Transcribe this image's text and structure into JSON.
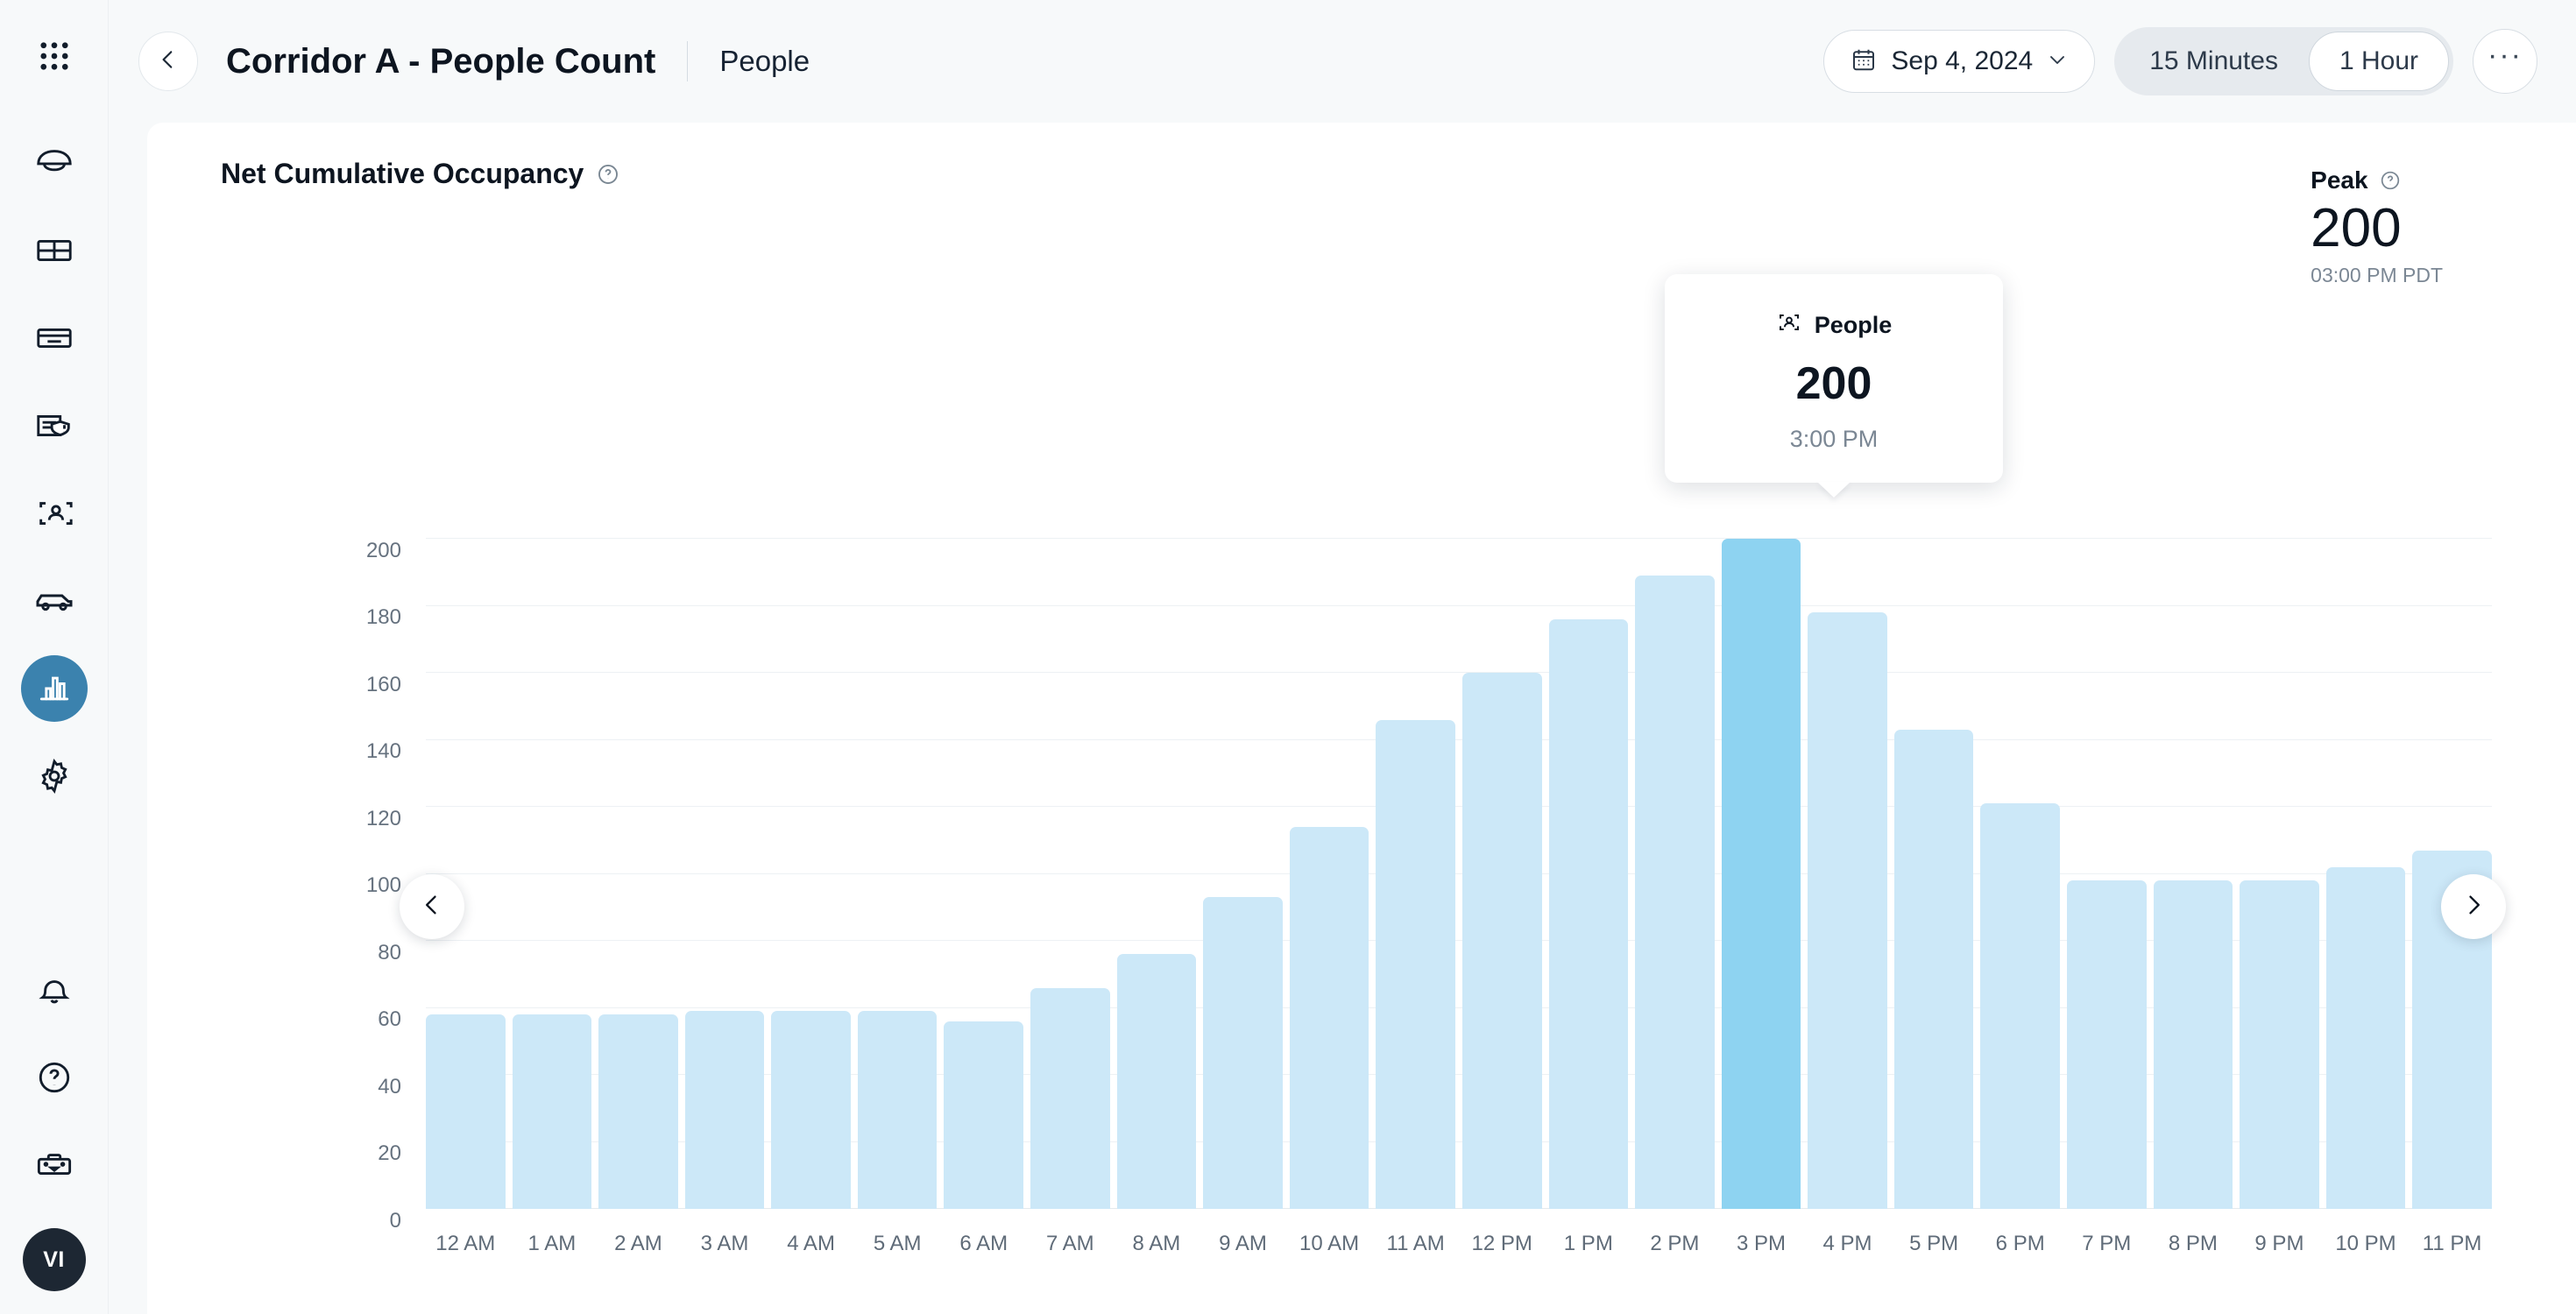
{
  "sidebar": {
    "items": [
      {
        "name": "apps-grid-icon",
        "label": "Apps"
      },
      {
        "name": "camera-dome-icon",
        "label": "Cameras"
      },
      {
        "name": "layout-grid-icon",
        "label": "Views"
      },
      {
        "name": "access-controller-icon",
        "label": "Access"
      },
      {
        "name": "alerts-document-icon",
        "label": "Alerts"
      },
      {
        "name": "people-detection-icon",
        "label": "People"
      },
      {
        "name": "vehicle-detection-icon",
        "label": "Vehicles"
      },
      {
        "name": "analytics-bar-chart-icon",
        "label": "Analytics"
      },
      {
        "name": "settings-gear-icon",
        "label": "Settings"
      },
      {
        "name": "notifications-bell-icon",
        "label": "Notifications"
      },
      {
        "name": "help-question-icon",
        "label": "Help"
      },
      {
        "name": "toolbox-icon",
        "label": "Toolbox"
      }
    ],
    "active_index": 7,
    "avatar_initials": "VI"
  },
  "header": {
    "back_label": "Back",
    "title": "Corridor A - People Count",
    "subtitle": "People",
    "date_value": "Sep 4, 2024",
    "interval_options": [
      "15 Minutes",
      "1 Hour"
    ],
    "interval_selected": "1 Hour",
    "more_label": "···"
  },
  "card": {
    "chart_title": "Net Cumulative Occupancy",
    "peak_label": "Peak",
    "peak_value": "200",
    "peak_time": "03:00 PM PDT"
  },
  "tooltip": {
    "metric": "People",
    "value": "200",
    "time": "3:00 PM"
  },
  "nav": {
    "prev_label": "Previous",
    "next_label": "Next"
  },
  "colors": {
    "bar": "#cce8f8",
    "bar_highlight": "#8ed3f1",
    "accent": "#3b82ae",
    "avatar_bg": "#1d2733",
    "page_bg": "#f7f9fa"
  },
  "chart_data": {
    "type": "bar",
    "title": "Net Cumulative Occupancy",
    "xlabel": "",
    "ylabel": "",
    "ylim": [
      0,
      200
    ],
    "yticks": [
      0,
      20,
      40,
      60,
      80,
      100,
      120,
      140,
      160,
      180,
      200
    ],
    "grid": true,
    "legend": "none",
    "highlight_index": 15,
    "categories": [
      "12 AM",
      "1 AM",
      "2 AM",
      "3 AM",
      "4 AM",
      "5 AM",
      "6 AM",
      "7 AM",
      "8 AM",
      "9 AM",
      "10 AM",
      "11 AM",
      "12 PM",
      "1 PM",
      "2 PM",
      "3 PM",
      "4 PM",
      "5 PM",
      "6 PM",
      "7 PM",
      "8 PM",
      "9 PM",
      "10 PM",
      "11 PM"
    ],
    "values": [
      58,
      58,
      58,
      59,
      59,
      59,
      56,
      66,
      76,
      93,
      114,
      146,
      160,
      176,
      189,
      200,
      178,
      143,
      121,
      98,
      98,
      98,
      102,
      107
    ]
  }
}
